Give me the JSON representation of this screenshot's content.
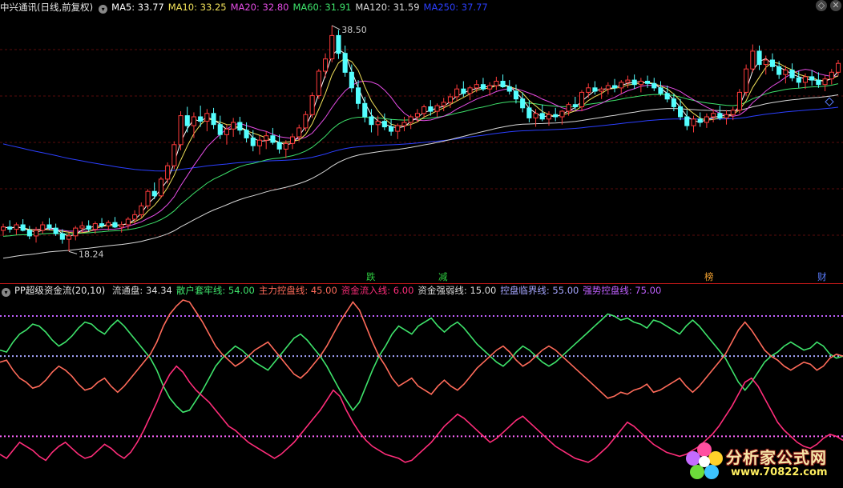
{
  "chart_data": [
    {
      "type": "candlestick",
      "title": "中兴通讯(日线,前复权)",
      "ma_legend": [
        {
          "name": "MA5",
          "value": "33.77",
          "color": "#ffffff"
        },
        {
          "name": "MA10",
          "value": "33.25",
          "color": "#f2e25a"
        },
        {
          "name": "MA20",
          "value": "32.80",
          "color": "#e64de6"
        },
        {
          "name": "MA60",
          "value": "31.91",
          "color": "#3ee36b"
        },
        {
          "name": "MA120",
          "value": "31.59",
          "color": "#d8d8d8"
        },
        {
          "name": "MA250",
          "value": "37.77",
          "color": "#2b3fff"
        }
      ],
      "annotations": {
        "high": "38.50",
        "low": "18.24"
      },
      "event_labels": [
        {
          "text": "跌",
          "color": "#2ecc40"
        },
        {
          "text": "减",
          "color": "#2ecc40"
        },
        {
          "text": "榜",
          "color": "#f0a030"
        },
        {
          "text": "财",
          "color": "#5a7dff"
        }
      ],
      "ylim": [
        16.5,
        39.5
      ],
      "ohlc": [
        [
          20.1,
          20.7,
          19.6,
          20.4
        ],
        [
          20.4,
          21.0,
          19.9,
          20.2
        ],
        [
          20.2,
          20.8,
          19.7,
          20.6
        ],
        [
          20.6,
          21.1,
          20.0,
          20.1
        ],
        [
          20.1,
          20.5,
          19.3,
          19.6
        ],
        [
          19.6,
          20.4,
          19.0,
          20.1
        ],
        [
          20.1,
          20.9,
          19.8,
          20.6
        ],
        [
          20.6,
          21.2,
          20.1,
          20.3
        ],
        [
          20.3,
          20.7,
          19.6,
          19.8
        ],
        [
          19.8,
          20.2,
          18.9,
          19.3
        ],
        [
          19.3,
          19.9,
          18.2,
          19.6
        ],
        [
          19.6,
          20.5,
          19.2,
          20.3
        ],
        [
          20.3,
          20.9,
          19.9,
          20.5
        ],
        [
          20.5,
          21.0,
          20.0,
          20.2
        ],
        [
          20.2,
          20.9,
          19.8,
          20.7
        ],
        [
          20.7,
          21.2,
          20.3,
          20.5
        ],
        [
          20.5,
          21.0,
          20.1,
          20.8
        ],
        [
          20.8,
          21.3,
          20.3,
          20.4
        ],
        [
          20.4,
          20.9,
          19.9,
          20.6
        ],
        [
          20.6,
          21.3,
          20.2,
          21.1
        ],
        [
          21.1,
          21.9,
          20.7,
          21.5
        ],
        [
          21.5,
          22.6,
          21.2,
          22.3
        ],
        [
          22.3,
          23.8,
          22.0,
          23.6
        ],
        [
          23.6,
          24.4,
          22.9,
          23.2
        ],
        [
          23.2,
          24.9,
          23.0,
          24.7
        ],
        [
          24.7,
          26.2,
          24.3,
          25.9
        ],
        [
          25.9,
          28.1,
          25.6,
          27.8
        ],
        [
          27.8,
          30.8,
          27.3,
          30.4
        ],
        [
          30.4,
          31.2,
          28.9,
          29.5
        ],
        [
          29.5,
          30.7,
          28.4,
          30.3
        ],
        [
          30.3,
          31.3,
          29.4,
          29.9
        ],
        [
          29.9,
          31.0,
          29.0,
          30.6
        ],
        [
          30.6,
          31.1,
          29.2,
          29.6
        ],
        [
          29.6,
          30.4,
          28.3,
          28.7
        ],
        [
          28.7,
          29.6,
          27.8,
          29.2
        ],
        [
          29.2,
          30.2,
          28.5,
          29.8
        ],
        [
          29.8,
          30.3,
          28.7,
          29.1
        ],
        [
          29.1,
          29.8,
          28.0,
          28.4
        ],
        [
          28.4,
          29.1,
          27.2,
          27.7
        ],
        [
          27.7,
          28.6,
          26.9,
          28.2
        ],
        [
          28.2,
          29.0,
          27.4,
          28.6
        ],
        [
          28.6,
          29.3,
          27.8,
          28.0
        ],
        [
          28.0,
          28.7,
          27.0,
          27.4
        ],
        [
          27.4,
          28.2,
          26.6,
          27.9
        ],
        [
          27.9,
          28.8,
          27.4,
          28.5
        ],
        [
          28.5,
          29.6,
          28.1,
          29.3
        ],
        [
          29.3,
          30.8,
          29.0,
          30.5
        ],
        [
          30.5,
          32.5,
          30.2,
          32.2
        ],
        [
          32.2,
          34.6,
          31.9,
          34.4
        ],
        [
          34.4,
          36.0,
          33.8,
          35.5
        ],
        [
          35.5,
          38.5,
          35.2,
          37.6
        ],
        [
          37.6,
          38.1,
          35.5,
          36.0
        ],
        [
          36.0,
          36.7,
          33.9,
          34.3
        ],
        [
          34.3,
          35.0,
          32.5,
          32.9
        ],
        [
          32.9,
          33.6,
          31.0,
          31.5
        ],
        [
          31.5,
          32.1,
          29.8,
          30.3
        ],
        [
          30.3,
          31.0,
          28.9,
          29.6
        ],
        [
          29.6,
          30.4,
          28.6,
          29.9
        ],
        [
          29.9,
          30.6,
          29.1,
          29.4
        ],
        [
          29.4,
          30.1,
          28.6,
          29.0
        ],
        [
          29.0,
          29.7,
          28.3,
          29.5
        ],
        [
          29.5,
          30.3,
          29.0,
          29.8
        ],
        [
          29.8,
          30.5,
          29.2,
          30.3
        ],
        [
          30.3,
          31.0,
          29.8,
          30.6
        ],
        [
          30.6,
          31.4,
          30.2,
          31.2
        ],
        [
          31.2,
          31.8,
          30.4,
          30.8
        ],
        [
          30.8,
          31.5,
          30.3,
          31.3
        ],
        [
          31.3,
          32.0,
          30.8,
          31.6
        ],
        [
          31.6,
          32.4,
          31.1,
          32.1
        ],
        [
          32.1,
          33.2,
          31.7,
          32.8
        ],
        [
          32.8,
          33.5,
          32.1,
          32.4
        ],
        [
          32.4,
          33.1,
          31.8,
          32.9
        ],
        [
          32.9,
          33.6,
          32.5,
          33.2
        ],
        [
          33.2,
          33.8,
          32.6,
          32.8
        ],
        [
          32.8,
          33.4,
          32.2,
          33.1
        ],
        [
          33.1,
          33.9,
          32.7,
          33.5
        ],
        [
          33.5,
          34.1,
          32.9,
          33.0
        ],
        [
          33.0,
          33.6,
          32.3,
          32.6
        ],
        [
          32.6,
          33.2,
          31.5,
          31.9
        ],
        [
          31.9,
          32.5,
          30.7,
          31.1
        ],
        [
          31.1,
          31.8,
          29.8,
          30.2
        ],
        [
          30.2,
          31.0,
          29.4,
          30.6
        ],
        [
          30.6,
          31.4,
          29.9,
          30.1
        ],
        [
          30.1,
          30.8,
          29.5,
          30.5
        ],
        [
          30.5,
          31.1,
          29.9,
          30.3
        ],
        [
          30.3,
          30.9,
          29.6,
          30.8
        ],
        [
          30.8,
          31.6,
          30.4,
          31.4
        ],
        [
          31.4,
          32.1,
          30.9,
          31.2
        ],
        [
          31.2,
          32.7,
          30.8,
          32.5
        ],
        [
          32.5,
          33.3,
          32.0,
          32.9
        ],
        [
          32.9,
          33.5,
          32.3,
          32.6
        ],
        [
          32.6,
          33.0,
          31.9,
          32.8
        ],
        [
          32.8,
          33.4,
          32.3,
          33.1
        ],
        [
          33.1,
          33.7,
          32.5,
          32.9
        ],
        [
          32.9,
          33.6,
          32.4,
          33.4
        ],
        [
          33.4,
          34.0,
          32.9,
          33.6
        ],
        [
          33.6,
          34.1,
          32.8,
          33.2
        ],
        [
          33.2,
          33.8,
          32.5,
          33.5
        ],
        [
          33.5,
          34.0,
          32.9,
          33.3
        ],
        [
          33.3,
          33.8,
          32.6,
          32.9
        ],
        [
          32.9,
          33.5,
          32.2,
          32.4
        ],
        [
          32.4,
          33.1,
          31.6,
          31.9
        ],
        [
          31.9,
          32.4,
          30.8,
          31.2
        ],
        [
          31.2,
          31.9,
          30.0,
          30.3
        ],
        [
          30.3,
          30.9,
          29.1,
          29.5
        ],
        [
          29.5,
          30.4,
          28.9,
          30.1
        ],
        [
          30.1,
          30.7,
          29.4,
          29.8
        ],
        [
          29.8,
          30.6,
          29.3,
          30.3
        ],
        [
          30.3,
          31.0,
          29.8,
          30.6
        ],
        [
          30.6,
          31.3,
          30.0,
          30.2
        ],
        [
          30.2,
          30.9,
          29.6,
          30.5
        ],
        [
          30.5,
          31.2,
          30.0,
          30.9
        ],
        [
          30.9,
          32.8,
          30.6,
          32.5
        ],
        [
          32.5,
          35.0,
          32.2,
          34.6
        ],
        [
          34.6,
          36.8,
          34.3,
          36.2
        ],
        [
          36.2,
          36.7,
          34.5,
          35.0
        ],
        [
          35.0,
          35.8,
          34.1,
          35.4
        ],
        [
          35.4,
          36.0,
          34.4,
          34.8
        ],
        [
          34.8,
          35.3,
          33.7,
          34.1
        ],
        [
          34.1,
          34.9,
          33.3,
          34.5
        ],
        [
          34.5,
          35.1,
          33.5,
          33.8
        ],
        [
          33.8,
          34.4,
          32.9,
          33.4
        ],
        [
          33.4,
          34.2,
          32.8,
          33.9
        ],
        [
          33.9,
          34.5,
          33.1,
          33.6
        ],
        [
          33.6,
          34.3,
          32.9,
          33.2
        ],
        [
          33.2,
          34.0,
          32.6,
          33.7
        ],
        [
          33.7,
          34.6,
          33.2,
          34.3
        ],
        [
          34.3,
          35.4,
          34.0,
          35.1
        ]
      ]
    },
    {
      "type": "line",
      "title": "PP超级资金流(20,10)",
      "params": [
        {
          "label": "流通盘:",
          "value": "34.34",
          "color": "#dddddd"
        },
        {
          "label": "散户套牢线:",
          "value": "54.00",
          "color": "#3ee36b"
        },
        {
          "label": "主力控盘线:",
          "value": "45.00",
          "color": "#ff6b5a"
        },
        {
          "label": "资金流入线:",
          "value": "6.00",
          "color": "#ff2d7a"
        },
        {
          "label": "资金强弱线:",
          "value": "15.00",
          "color": "#dddddd"
        },
        {
          "label": "控盘临界线:",
          "value": "55.00",
          "color": "#a6a6ff"
        },
        {
          "label": "强势控盘线:",
          "value": "75.00",
          "color": "#c060ff"
        }
      ],
      "reference_lines": [
        75,
        55,
        15
      ],
      "ylim": [
        -10,
        85
      ],
      "series": [
        {
          "name": "散户套牢线",
          "color": "#3ee36b",
          "values": [
            58,
            57,
            62,
            66,
            68,
            71,
            70,
            67,
            63,
            60,
            62,
            65,
            69,
            72,
            71,
            68,
            66,
            70,
            73,
            70,
            66,
            62,
            58,
            54,
            48,
            40,
            34,
            30,
            27,
            28,
            33,
            38,
            44,
            50,
            54,
            57,
            60,
            58,
            55,
            52,
            50,
            48,
            52,
            56,
            60,
            64,
            66,
            63,
            59,
            55,
            50,
            44,
            38,
            33,
            28,
            32,
            40,
            48,
            55,
            60,
            66,
            70,
            68,
            66,
            70,
            72,
            74,
            70,
            67,
            70,
            72,
            69,
            65,
            61,
            58,
            55,
            52,
            50,
            53,
            57,
            60,
            58,
            55,
            52,
            50,
            52,
            55,
            58,
            61,
            64,
            67,
            70,
            73,
            76,
            75,
            73,
            74,
            72,
            71,
            69,
            73,
            72,
            70,
            68,
            66,
            70,
            73,
            70,
            66,
            62,
            58,
            54,
            48,
            42,
            38,
            42,
            47,
            52,
            55,
            57,
            60,
            62,
            60,
            58,
            59,
            62,
            60,
            56,
            54,
            55
          ]
        },
        {
          "name": "主力控盘线",
          "color": "#ff6b5a",
          "values": [
            52,
            53,
            48,
            44,
            42,
            39,
            40,
            43,
            47,
            50,
            48,
            45,
            41,
            38,
            39,
            42,
            44,
            40,
            37,
            40,
            44,
            48,
            52,
            56,
            62,
            70,
            76,
            80,
            83,
            82,
            77,
            72,
            66,
            60,
            56,
            53,
            50,
            52,
            55,
            58,
            60,
            62,
            58,
            54,
            50,
            46,
            44,
            47,
            51,
            55,
            60,
            66,
            72,
            77,
            82,
            78,
            70,
            62,
            55,
            50,
            44,
            40,
            42,
            44,
            40,
            38,
            36,
            40,
            43,
            40,
            38,
            41,
            45,
            49,
            52,
            55,
            58,
            60,
            57,
            53,
            50,
            52,
            55,
            58,
            60,
            58,
            55,
            52,
            49,
            46,
            43,
            40,
            37,
            34,
            35,
            37,
            36,
            38,
            39,
            41,
            37,
            38,
            40,
            42,
            44,
            40,
            37,
            40,
            44,
            48,
            52,
            56,
            62,
            68,
            72,
            68,
            63,
            58,
            55,
            53,
            50,
            48,
            50,
            52,
            51,
            48,
            50,
            54,
            56,
            55
          ]
        },
        {
          "name": "资金流入线",
          "color": "#ff2d7a",
          "values": [
            6,
            4,
            8,
            12,
            10,
            8,
            5,
            3,
            7,
            10,
            12,
            9,
            6,
            4,
            5,
            8,
            11,
            9,
            6,
            4,
            7,
            12,
            18,
            25,
            32,
            40,
            46,
            50,
            47,
            42,
            38,
            35,
            32,
            28,
            24,
            20,
            18,
            15,
            12,
            10,
            8,
            6,
            4,
            6,
            9,
            12,
            16,
            20,
            24,
            28,
            33,
            38,
            35,
            28,
            22,
            17,
            13,
            10,
            8,
            6,
            5,
            4,
            2,
            3,
            6,
            9,
            12,
            16,
            20,
            23,
            26,
            24,
            21,
            18,
            15,
            12,
            14,
            17,
            20,
            23,
            25,
            22,
            19,
            16,
            13,
            10,
            8,
            6,
            4,
            3,
            2,
            4,
            7,
            10,
            14,
            18,
            22,
            20,
            17,
            14,
            11,
            9,
            7,
            6,
            5,
            6,
            8,
            10,
            13,
            16,
            20,
            25,
            30,
            36,
            42,
            44,
            40,
            34,
            28,
            22,
            18,
            15,
            12,
            10,
            9,
            11,
            14,
            16,
            15,
            13
          ]
        }
      ]
    }
  ],
  "logo": {
    "name": "分析家公式网",
    "url": "www.70822.com"
  },
  "ui": {
    "toggle_icon": "chevron-down-icon",
    "window_buttons": [
      "◇",
      "✕"
    ]
  }
}
